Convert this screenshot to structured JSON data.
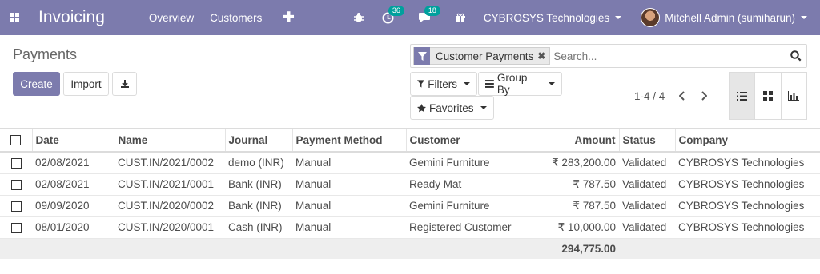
{
  "navbar": {
    "brand": "Invoicing",
    "menus": [
      "Overview",
      "Customers"
    ],
    "activity_count": "36",
    "messages_count": "18",
    "company": "CYBROSYS Technologies",
    "user": "Mitchell Admin (sumiharun)",
    "color": "#7c7bad"
  },
  "control_panel": {
    "title": "Payments",
    "create_label": "Create",
    "import_label": "Import",
    "search": {
      "facet_value": "Customer Payments",
      "placeholder": "Search..."
    },
    "filters_label": "Filters",
    "group_by_label": "Group By",
    "favorites_label": "Favorites",
    "pager": "1-4 / 4"
  },
  "table": {
    "columns": [
      "Date",
      "Name",
      "Journal",
      "Payment Method",
      "Customer",
      "Amount",
      "Status",
      "Company"
    ],
    "rows": [
      {
        "date": "02/08/2021",
        "name": "CUST.IN/2021/0002",
        "journal": "demo (INR)",
        "method": "Manual",
        "customer": "Gemini Furniture",
        "amount": "₹ 283,200.00",
        "status": "Validated",
        "company": "CYBROSYS Technologies"
      },
      {
        "date": "02/08/2021",
        "name": "CUST.IN/2021/0001",
        "journal": "Bank (INR)",
        "method": "Manual",
        "customer": "Ready Mat",
        "amount": "₹ 787.50",
        "status": "Validated",
        "company": "CYBROSYS Technologies"
      },
      {
        "date": "09/09/2020",
        "name": "CUST.IN/2020/0002",
        "journal": "Bank (INR)",
        "method": "Manual",
        "customer": "Gemini Furniture",
        "amount": "₹ 787.50",
        "status": "Validated",
        "company": "CYBROSYS Technologies"
      },
      {
        "date": "08/01/2020",
        "name": "CUST.IN/2020/0001",
        "journal": "Cash (INR)",
        "method": "Manual",
        "customer": "Registered Customer",
        "amount": "₹ 10,000.00",
        "status": "Validated",
        "company": "CYBROSYS Technologies"
      }
    ],
    "total": "294,775.00"
  }
}
